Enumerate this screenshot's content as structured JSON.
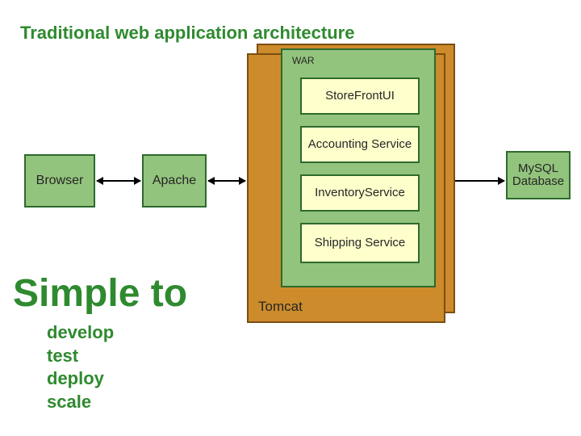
{
  "title": "Traditional web application architecture",
  "nodes": {
    "browser": "Browser",
    "apache": "Apache",
    "tomcat": "Tomcat",
    "war": "WAR",
    "db_line1": "MySQL",
    "db_line2": "Database"
  },
  "services": {
    "ui": "StoreFrontUI",
    "accounting": "Accounting Service",
    "inventory": "InventoryService",
    "shipping": "Shipping Service"
  },
  "callout": {
    "heading": "Simple to",
    "develop": "develop",
    "test": "test",
    "deploy": "deploy",
    "scale": "scale"
  },
  "colors": {
    "green_text": "#2f8a2f",
    "green_box": "#93c47d",
    "green_border": "#2d6a2d",
    "yellow_box": "#ffffcc",
    "orange_box": "#cd8b2b",
    "orange_border": "#7a4e13"
  }
}
